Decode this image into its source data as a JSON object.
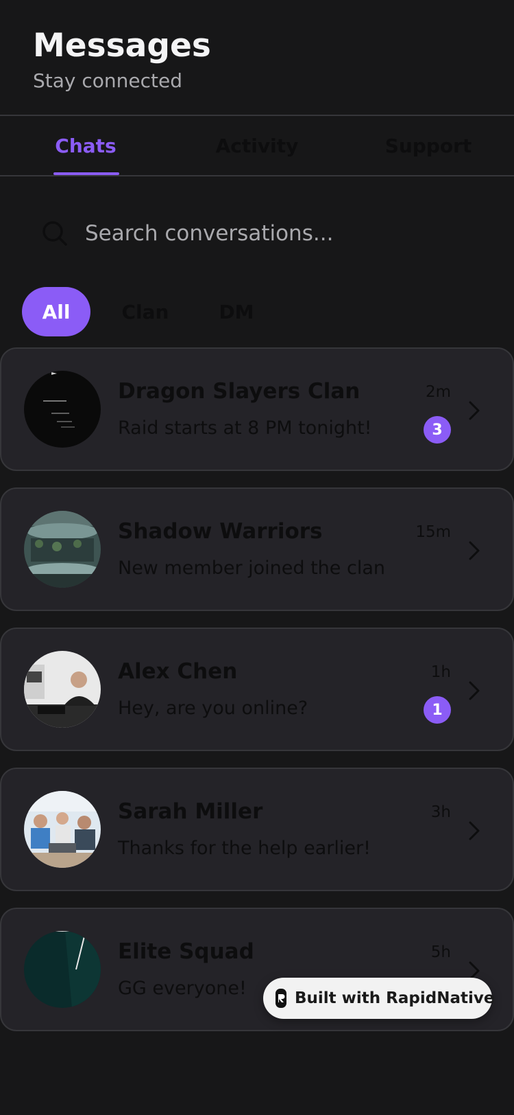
{
  "header": {
    "title": "Messages",
    "subtitle": "Stay connected"
  },
  "tabs": [
    {
      "label": "Chats",
      "active": true
    },
    {
      "label": "Activity",
      "active": false
    },
    {
      "label": "Support",
      "active": false
    }
  ],
  "search": {
    "placeholder": "Search conversations...",
    "value": ""
  },
  "filters": [
    {
      "label": "All",
      "active": true
    },
    {
      "label": "Clan",
      "active": false
    },
    {
      "label": "DM",
      "active": false
    }
  ],
  "chats": [
    {
      "name": "Dragon Slayers Clan",
      "preview": "Raid starts at 8 PM tonight!",
      "time": "2m",
      "unread": "3"
    },
    {
      "name": "Shadow Warriors",
      "preview": "New member joined the clan",
      "time": "15m",
      "unread": ""
    },
    {
      "name": "Alex Chen",
      "preview": "Hey, are you online?",
      "time": "1h",
      "unread": "1"
    },
    {
      "name": "Sarah Miller",
      "preview": "Thanks for the help earlier!",
      "time": "3h",
      "unread": ""
    },
    {
      "name": "Elite Squad",
      "preview": "GG everyone!",
      "time": "5h",
      "unread": ""
    }
  ],
  "built_with": {
    "label": "Built with RapidNative"
  },
  "colors": {
    "accent": "#8b5cf6",
    "background": "#171718",
    "card": "#242328"
  }
}
